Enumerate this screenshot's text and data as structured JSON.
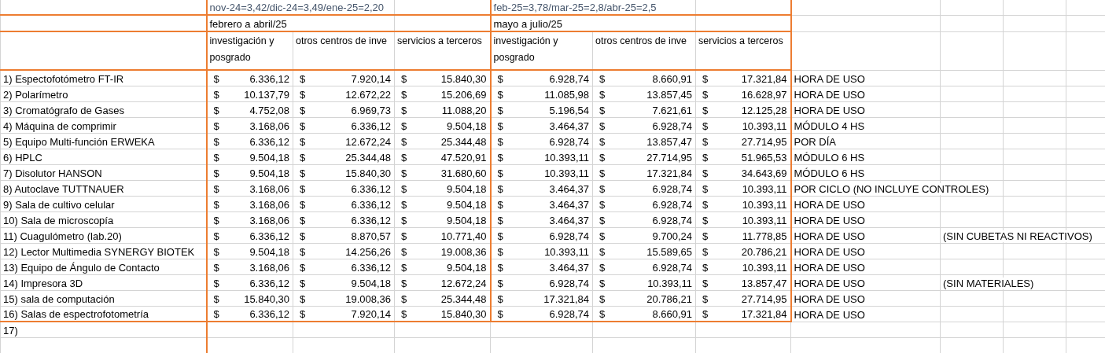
{
  "sheet": {
    "periods": [
      {
        "rate_note": "nov-24=3,42/dic-24=3,49/ene-25=2,20",
        "label": "febrero a abril/25",
        "columns": [
          "investigación y posgrado",
          "otros centros de inve",
          "servicios a terceros"
        ]
      },
      {
        "rate_note": "feb-25=3,78/mar-25=2,8/abr-25=2,5",
        "label": "mayo a julio/25",
        "columns": [
          "investigación y posgrado",
          "otros centros de inve",
          "servicios a terceros"
        ]
      }
    ],
    "rows": [
      {
        "item": "1) Espectofotómetro FT-IR",
        "prices": [
          {
            "currency": "$",
            "amount": "6.336,12"
          },
          {
            "currency": "$",
            "amount": "7.920,14"
          },
          {
            "currency": "$",
            "amount": "15.840,30"
          },
          {
            "currency": "$",
            "amount": "6.928,74"
          },
          {
            "currency": "$",
            "amount": "8.660,91"
          },
          {
            "currency": "$",
            "amount": "17.321,84"
          }
        ],
        "unit": "HORA DE USO"
      },
      {
        "item": "2) Polarímetro",
        "prices": [
          {
            "currency": "$",
            "amount": "10.137,79"
          },
          {
            "currency": "$",
            "amount": "12.672,22"
          },
          {
            "currency": "$",
            "amount": "15.206,69"
          },
          {
            "currency": "$",
            "amount": "11.085,98"
          },
          {
            "currency": "$",
            "amount": "13.857,45"
          },
          {
            "currency": "$",
            "amount": "16.628,97"
          }
        ],
        "unit": "HORA DE USO"
      },
      {
        "item": "3) Cromatógrafo de Gases",
        "prices": [
          {
            "currency": "$",
            "amount": "4.752,08"
          },
          {
            "currency": "$",
            "amount": "6.969,73"
          },
          {
            "currency": "$",
            "amount": "11.088,20"
          },
          {
            "currency": "$",
            "amount": "5.196,54"
          },
          {
            "currency": "$",
            "amount": "7.621,61"
          },
          {
            "currency": "$",
            "amount": "12.125,28"
          }
        ],
        "unit": "HORA DE USO"
      },
      {
        "item": "4) Máquina de comprimir",
        "prices": [
          {
            "currency": "$",
            "amount": "3.168,06"
          },
          {
            "currency": "$",
            "amount": "6.336,12"
          },
          {
            "currency": "$",
            "amount": "9.504,18"
          },
          {
            "currency": "$",
            "amount": "3.464,37"
          },
          {
            "currency": "$",
            "amount": "6.928,74"
          },
          {
            "currency": "$",
            "amount": "10.393,11"
          }
        ],
        "unit": "MÓDULO 4 HS"
      },
      {
        "item": "5) Equipo Multi-función ERWEKA",
        "prices": [
          {
            "currency": "$",
            "amount": "6.336,12"
          },
          {
            "currency": "$",
            "amount": "12.672,24"
          },
          {
            "currency": "$",
            "amount": "25.344,48"
          },
          {
            "currency": "$",
            "amount": "6.928,74"
          },
          {
            "currency": "$",
            "amount": "13.857,47"
          },
          {
            "currency": "$",
            "amount": "27.714,95"
          }
        ],
        "unit": "POR DÍA"
      },
      {
        "item": "6) HPLC",
        "prices": [
          {
            "currency": "$",
            "amount": "9.504,18"
          },
          {
            "currency": "$",
            "amount": "25.344,48"
          },
          {
            "currency": "$",
            "amount": "47.520,91"
          },
          {
            "currency": "$",
            "amount": "10.393,11"
          },
          {
            "currency": "$",
            "amount": "27.714,95"
          },
          {
            "currency": "$",
            "amount": "51.965,53"
          }
        ],
        "unit": "MÓDULO 6 HS"
      },
      {
        "item": "7) Disolutor HANSON",
        "prices": [
          {
            "currency": "$",
            "amount": "9.504,18"
          },
          {
            "currency": "$",
            "amount": "15.840,30"
          },
          {
            "currency": "$",
            "amount": "31.680,60"
          },
          {
            "currency": "$",
            "amount": "10.393,11"
          },
          {
            "currency": "$",
            "amount": "17.321,84"
          },
          {
            "currency": "$",
            "amount": "34.643,69"
          }
        ],
        "unit": "MÓDULO 6 HS"
      },
      {
        "item": "8) Autoclave TUTTNAUER",
        "prices": [
          {
            "currency": "$",
            "amount": "3.168,06"
          },
          {
            "currency": "$",
            "amount": "6.336,12"
          },
          {
            "currency": "$",
            "amount": "9.504,18"
          },
          {
            "currency": "$",
            "amount": "3.464,37"
          },
          {
            "currency": "$",
            "amount": "6.928,74"
          },
          {
            "currency": "$",
            "amount": "10.393,11"
          }
        ],
        "unit": "POR CICLO (NO INCLUYE CONTROLES)"
      },
      {
        "item": "9) Sala de cultivo celular",
        "prices": [
          {
            "currency": "$",
            "amount": "3.168,06"
          },
          {
            "currency": "$",
            "amount": "6.336,12"
          },
          {
            "currency": "$",
            "amount": "9.504,18"
          },
          {
            "currency": "$",
            "amount": "3.464,37"
          },
          {
            "currency": "$",
            "amount": "6.928,74"
          },
          {
            "currency": "$",
            "amount": "10.393,11"
          }
        ],
        "unit": "HORA DE USO"
      },
      {
        "item": "10) Sala de microscopía",
        "prices": [
          {
            "currency": "$",
            "amount": "3.168,06"
          },
          {
            "currency": "$",
            "amount": "6.336,12"
          },
          {
            "currency": "$",
            "amount": "9.504,18"
          },
          {
            "currency": "$",
            "amount": "3.464,37"
          },
          {
            "currency": "$",
            "amount": "6.928,74"
          },
          {
            "currency": "$",
            "amount": "10.393,11"
          }
        ],
        "unit": "HORA DE USO"
      },
      {
        "item": "11) Cuagulómetro (lab.20)",
        "prices": [
          {
            "currency": "$",
            "amount": "6.336,12"
          },
          {
            "currency": "$",
            "amount": "8.870,57"
          },
          {
            "currency": "$",
            "amount": "10.771,40"
          },
          {
            "currency": "$",
            "amount": "6.928,74"
          },
          {
            "currency": "$",
            "amount": "9.700,24"
          },
          {
            "currency": "$",
            "amount": "11.778,85"
          }
        ],
        "unit": "HORA DE USO",
        "remark": "(SIN CUBETAS NI REACTIVOS)"
      },
      {
        "item": "12) Lector Multimedia SYNERGY BIOTEK",
        "prices": [
          {
            "currency": "$",
            "amount": "9.504,18"
          },
          {
            "currency": "$",
            "amount": "14.256,26"
          },
          {
            "currency": "$",
            "amount": "19.008,36"
          },
          {
            "currency": "$",
            "amount": "10.393,11"
          },
          {
            "currency": "$",
            "amount": "15.589,65"
          },
          {
            "currency": "$",
            "amount": "20.786,21"
          }
        ],
        "unit": "HORA DE USO"
      },
      {
        "item": "13) Equipo de Ángulo de Contacto",
        "prices": [
          {
            "currency": "$",
            "amount": "3.168,06"
          },
          {
            "currency": "$",
            "amount": "6.336,12"
          },
          {
            "currency": "$",
            "amount": "9.504,18"
          },
          {
            "currency": "$",
            "amount": "3.464,37"
          },
          {
            "currency": "$",
            "amount": "6.928,74"
          },
          {
            "currency": "$",
            "amount": "10.393,11"
          }
        ],
        "unit": "HORA DE USO"
      },
      {
        "item": "14) Impresora 3D",
        "prices": [
          {
            "currency": "$",
            "amount": "6.336,12"
          },
          {
            "currency": "$",
            "amount": "9.504,18"
          },
          {
            "currency": "$",
            "amount": "12.672,24"
          },
          {
            "currency": "$",
            "amount": "6.928,74"
          },
          {
            "currency": "$",
            "amount": "10.393,11"
          },
          {
            "currency": "$",
            "amount": "13.857,47"
          }
        ],
        "unit": "HORA DE USO",
        "remark": "(SIN MATERIALES)"
      },
      {
        "item": "15) sala de computación",
        "prices": [
          {
            "currency": "$",
            "amount": "15.840,30"
          },
          {
            "currency": "$",
            "amount": "19.008,36"
          },
          {
            "currency": "$",
            "amount": "25.344,48"
          },
          {
            "currency": "$",
            "amount": "17.321,84"
          },
          {
            "currency": "$",
            "amount": "20.786,21"
          },
          {
            "currency": "$",
            "amount": "27.714,95"
          }
        ],
        "unit": "HORA DE USO"
      },
      {
        "item": "16) Salas de espectrofotometría",
        "prices": [
          {
            "currency": "$",
            "amount": "6.336,12"
          },
          {
            "currency": "$",
            "amount": "7.920,14"
          },
          {
            "currency": "$",
            "amount": "15.840,30"
          },
          {
            "currency": "$",
            "amount": "6.928,74"
          },
          {
            "currency": "$",
            "amount": "8.660,91"
          },
          {
            "currency": "$",
            "amount": "17.321,84"
          }
        ],
        "unit": "HORA DE USO"
      }
    ],
    "last_item": "17)"
  }
}
